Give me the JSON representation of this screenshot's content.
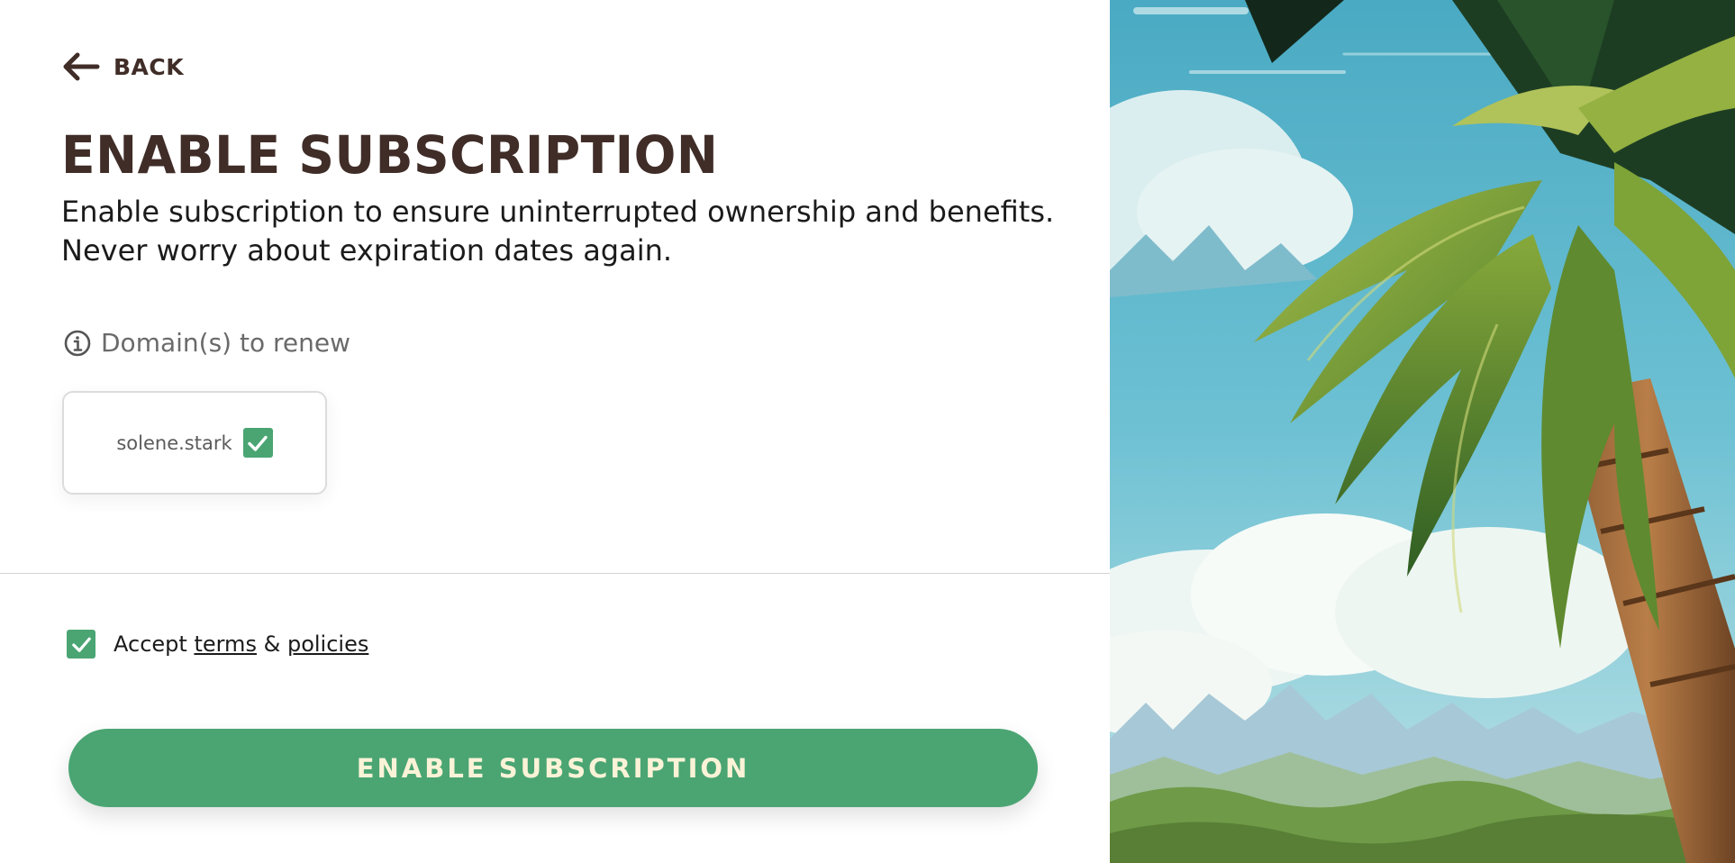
{
  "back": {
    "label": "Back"
  },
  "title": "Enable subscription",
  "description": "Enable subscription to ensure uninterrupted ownership and benefits. Never worry about expiration dates again.",
  "domains": {
    "label": "Domain(s) to renew",
    "items": [
      {
        "name": "solene.stark",
        "checked": true
      }
    ]
  },
  "terms": {
    "checked": true,
    "prefix": "Accept",
    "terms_link": "terms",
    "separator": "&",
    "policies_link": "policies"
  },
  "submit": {
    "label": "Enable subscription"
  },
  "colors": {
    "accent": "#4aa573",
    "title": "#402d28",
    "button_text": "#fbf3d7"
  },
  "icons": {
    "back": "arrow-left-icon",
    "info": "info-circle-icon",
    "check": "checkmark-icon"
  }
}
